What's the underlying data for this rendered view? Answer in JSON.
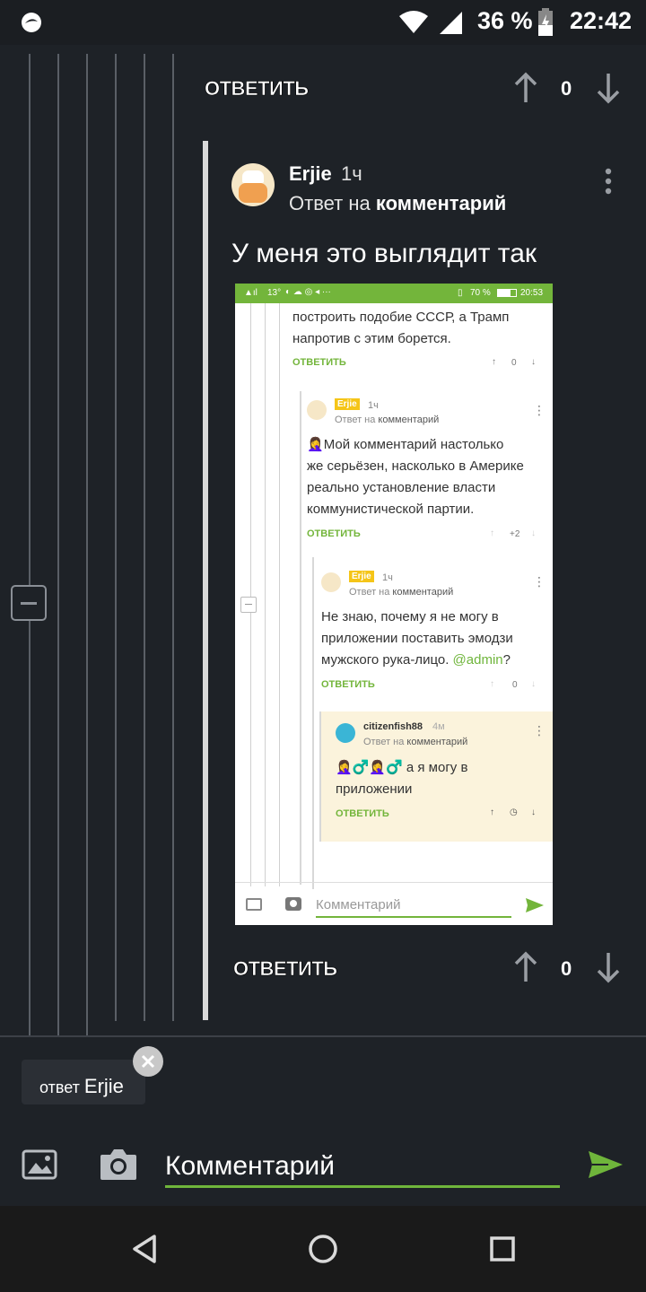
{
  "status_bar": {
    "battery": "36 %",
    "time": "22:42"
  },
  "thread": {
    "top_reply": {
      "label": "ОТВЕТИТЬ",
      "score": "0"
    },
    "comment": {
      "author": "Erjie",
      "time": "1ч",
      "reply_prefix": "Ответ на",
      "reply_link": "комментарий",
      "text": "У меня это выглядит так",
      "reply_label": "ОТВЕТИТЬ",
      "score": "0"
    }
  },
  "embedded": {
    "status_left": "13°",
    "status_right": "70 %",
    "status_time": "20:53",
    "c1_text1": "построить подобие СССР, а Трамп",
    "c1_text2": "напротив с этим борется.",
    "c1_reply": "ОТВЕТИТЬ",
    "c1_score": "0",
    "c2_author": "Erjie",
    "c2_time": "1ч",
    "c2_reply_prefix": "Ответ на",
    "c2_reply_link": "комментарий",
    "c2_line1": "Мой комментарий настолько",
    "c2_line2": "же серьёзен, насколько в Америке",
    "c2_line3": "реально установление власти",
    "c2_line4": "коммунистической партии.",
    "c2_reply": "ОТВЕТИТЬ",
    "c2_score": "+2",
    "c3_author": "Erjie",
    "c3_time": "1ч",
    "c3_reply_prefix": "Ответ на",
    "c3_reply_link": "комментарий",
    "c3_line1": "Не знаю, почему я не могу в",
    "c3_line2": "приложении поставить эмодзи",
    "c3_line3_a": "мужского рука-лицо. ",
    "c3_mention": "@admin",
    "c3_line3_b": "?",
    "c3_reply": "ОТВЕТИТЬ",
    "c3_score": "0",
    "c4_author": "citizenfish88",
    "c4_time": "4м",
    "c4_reply_prefix": "Ответ на",
    "c4_reply_link": "комментарий",
    "c4_line1": "а я могу в",
    "c4_line2": "приложении",
    "c4_reply": "ОТВЕТИТЬ",
    "input_placeholder": "Комментарий"
  },
  "reply_chip": {
    "prefix": "ответ",
    "name": "Erjie"
  },
  "composer": {
    "placeholder": "Комментарий"
  },
  "colors": {
    "accent": "#6fb53b",
    "background": "#1e2227",
    "badge": "#f5c518"
  }
}
